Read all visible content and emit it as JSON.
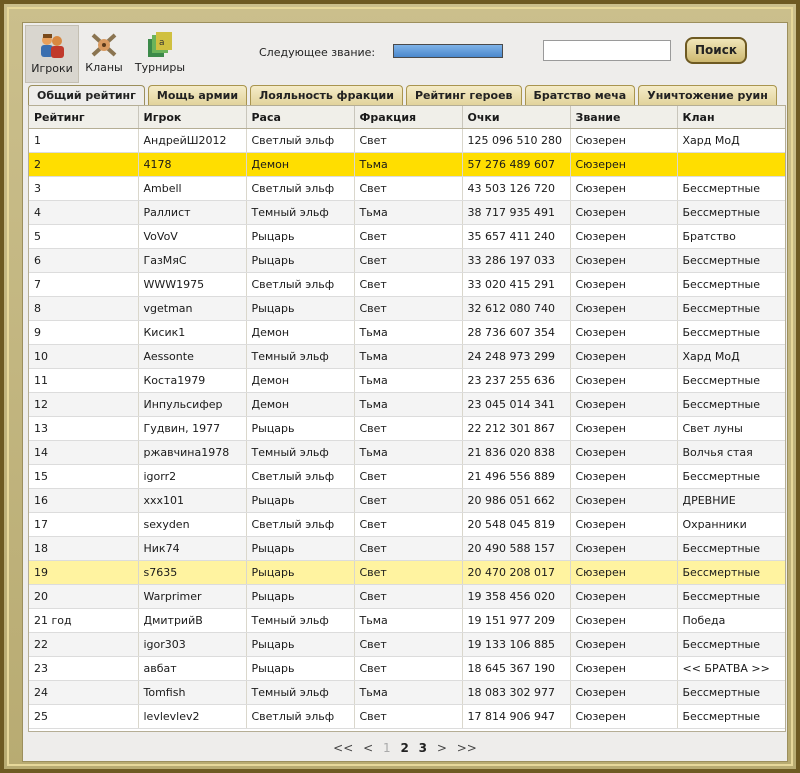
{
  "nav": [
    {
      "label": "Игроки",
      "icon": "players-icon"
    },
    {
      "label": "Кланы",
      "icon": "clans-icon"
    },
    {
      "label": "Турниры",
      "icon": "tournaments-icon"
    }
  ],
  "header": {
    "next_rank_label": "Следующее звание:",
    "next_rank_progress": 1.0,
    "search_placeholder": "",
    "search_button": "Поиск"
  },
  "tabs": [
    "Общий рейтинг",
    "Мощь армии",
    "Лояльность фракции",
    "Рейтинг героев",
    "Братство меча",
    "Уничтожение руин"
  ],
  "table": {
    "columns": [
      "Рейтинг",
      "Игрок",
      "Раса",
      "Фракция",
      "Очки",
      "Звание",
      "Клан"
    ],
    "rows": [
      [
        "1",
        "АндрейШ2012",
        "Светлый эльф",
        "Свет",
        "125 096 510 280",
        "Сюзерен",
        "Хард МоД"
      ],
      [
        "2",
        "4178",
        "Демон",
        "Тьма",
        "57 276 489 607",
        "Сюзерен",
        ""
      ],
      [
        "3",
        "Ambell",
        "Светлый эльф",
        "Свет",
        "43 503 126 720",
        "Сюзерен",
        "Бессмертные"
      ],
      [
        "4",
        "Раллист",
        "Темный эльф",
        "Тьма",
        "38 717 935 491",
        "Сюзерен",
        "Бессмертные"
      ],
      [
        "5",
        "VoVoV",
        "Рыцарь",
        "Свет",
        "35 657 411 240",
        "Сюзерен",
        "Братство"
      ],
      [
        "6",
        "ГазМяС",
        "Рыцарь",
        "Свет",
        "33 286 197 033",
        "Сюзерен",
        "Бессмертные"
      ],
      [
        "7",
        "WWW1975",
        "Светлый эльф",
        "Свет",
        "33 020 415 291",
        "Сюзерен",
        "Бессмертные"
      ],
      [
        "8",
        "vgetman",
        "Рыцарь",
        "Свет",
        "32 612 080 740",
        "Сюзерен",
        "Бессмертные"
      ],
      [
        "9",
        "Кисик1",
        "Демон",
        "Тьма",
        "28 736 607 354",
        "Сюзерен",
        "Бессмертные"
      ],
      [
        "10",
        "Aessonte",
        "Темный эльф",
        "Тьма",
        "24 248 973 299",
        "Сюзерен",
        "Хард МоД"
      ],
      [
        "11",
        "Коста1979",
        "Демон",
        "Тьма",
        "23 237 255 636",
        "Сюзерен",
        "Бессмертные"
      ],
      [
        "12",
        "Инпульсифер",
        "Демон",
        "Тьма",
        "23 045 014 341",
        "Сюзерен",
        "Бессмертные"
      ],
      [
        "13",
        "Гудвин, 1977",
        "Рыцарь",
        "Свет",
        "22 212 301 867",
        "Сюзерен",
        "Свет луны"
      ],
      [
        "14",
        "ржавчина1978",
        "Темный эльф",
        "Тьма",
        "21 836 020 838",
        "Сюзерен",
        "Волчья стая"
      ],
      [
        "15",
        "igorr2",
        "Светлый эльф",
        "Свет",
        "21 496 556 889",
        "Сюзерен",
        "Бессмертные"
      ],
      [
        "16",
        "xxx101",
        "Рыцарь",
        "Свет",
        "20 986 051 662",
        "Сюзерен",
        "ДРЕВНИЕ"
      ],
      [
        "17",
        "sexyden",
        "Светлый эльф",
        "Свет",
        "20 548 045 819",
        "Сюзерен",
        "Охранники"
      ],
      [
        "18",
        "Ник74",
        "Рыцарь",
        "Свет",
        "20 490 588 157",
        "Сюзерен",
        "Бессмертные"
      ],
      [
        "19",
        "s7635",
        "Рыцарь",
        "Свет",
        "20 470 208 017",
        "Сюзерен",
        "Бессмертные"
      ],
      [
        "20",
        "Warprimer",
        "Рыцарь",
        "Свет",
        "19 358 456 020",
        "Сюзерен",
        "Бессмертные"
      ],
      [
        "21 год",
        "ДмитрийВ",
        "Темный эльф",
        "Тьма",
        "19 151 977 209",
        "Сюзерен",
        "Победа"
      ],
      [
        "22",
        "igor303",
        "Рыцарь",
        "Свет",
        "19 133 106 885",
        "Сюзерен",
        "Бессмертные"
      ],
      [
        "23",
        "авбат",
        "Рыцарь",
        "Свет",
        "18 645 367 190",
        "Сюзерен",
        "<< БРАТВА >>"
      ],
      [
        "24",
        "Tomfish",
        "Темный эльф",
        "Тьма",
        "18 083 302 977",
        "Сюзерен",
        "Бессмертные"
      ],
      [
        "25",
        "levlevlev2",
        "Светлый эльф",
        "Свет",
        "17 814 906 947",
        "Сюзерен",
        "Бессмертные"
      ]
    ],
    "highlight_strong_row": 1,
    "highlight_light_row": 18
  },
  "pager": {
    "first": "<<",
    "prev": "<",
    "pages": [
      "1",
      "2",
      "3"
    ],
    "current": "1",
    "next": ">",
    "last": ">>"
  },
  "colors": {
    "highlight_strong": "#ffde00",
    "highlight_light": "#fff3a0",
    "progress": "#4b88cc",
    "frame": "#6e5a22"
  }
}
